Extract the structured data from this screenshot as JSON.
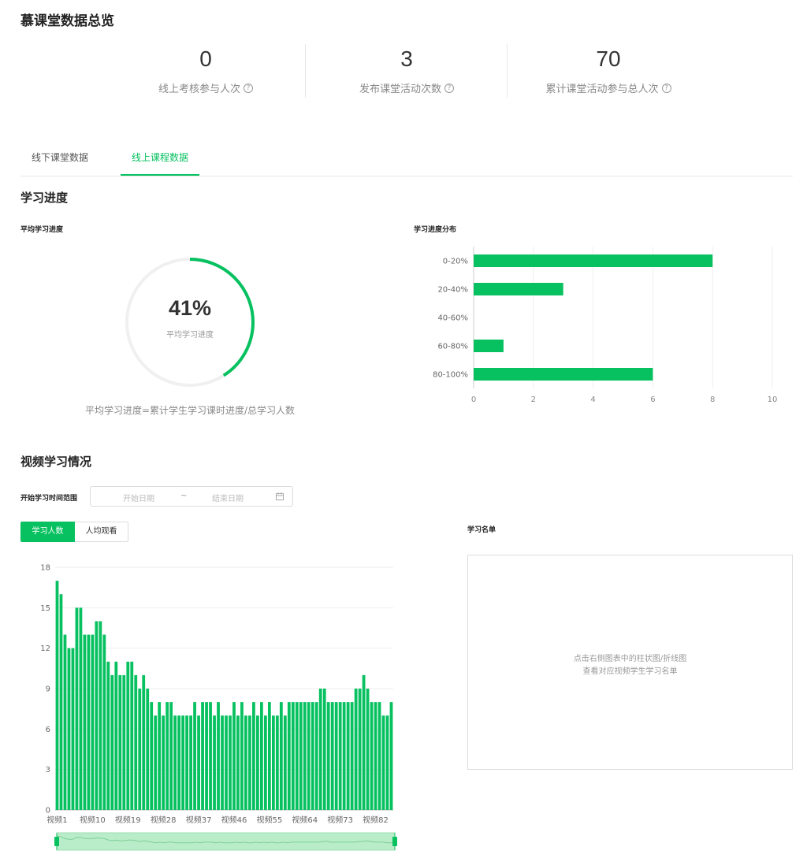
{
  "page_title": "慕课堂数据总览",
  "stats": [
    {
      "value": "0",
      "label": "线上考核参与人次",
      "help_icon": "question-circle-icon"
    },
    {
      "value": "3",
      "label": "发布课堂活动次数",
      "help_icon": "question-circle-icon"
    },
    {
      "value": "70",
      "label": "累计课堂活动参与总人次",
      "help_icon": "question-circle-icon"
    }
  ],
  "help_glyph": "?",
  "tabs": [
    {
      "label": "线下课堂数据",
      "active": false
    },
    {
      "label": "线上课程数据",
      "active": true
    }
  ],
  "progress_section": {
    "title": "学习进度",
    "avg_title": "平均学习进度",
    "avg_value": "41%",
    "avg_fraction": 0.41,
    "avg_label": "平均学习进度",
    "avg_caption": "平均学习进度=累计学生学习课时进度/总学习人数",
    "dist_title": "学习进度分布"
  },
  "video_section": {
    "title": "视频学习情况",
    "range_label": "开始学习时间范围",
    "start_placeholder": "开始日期",
    "separator": "~",
    "end_placeholder": "结束日期",
    "calendar_icon": "calendar-icon",
    "segments": [
      {
        "label": "学习人数",
        "active": true
      },
      {
        "label": "人均观看",
        "active": false
      }
    ],
    "list_title": "学习名单",
    "list_hint_1": "点击右侧图表中的柱状图/折线图",
    "list_hint_2": "查看对应视频学生学习名单"
  },
  "colors": {
    "accent": "#07c160",
    "ring_track": "#f0f0f0",
    "grid": "#eeeeee",
    "axis_text": "#666666"
  },
  "chart_data": [
    {
      "type": "bar",
      "orientation": "horizontal",
      "title": "学习进度分布",
      "categories": [
        "0-20%",
        "20-40%",
        "40-60%",
        "60-80%",
        "80-100%"
      ],
      "values": [
        8,
        3,
        0,
        1,
        6
      ],
      "xlim": [
        0,
        10
      ],
      "x_ticks": [
        0,
        2,
        4,
        6,
        8,
        10
      ],
      "grid": "vertical"
    },
    {
      "type": "bar",
      "title": "",
      "categories": [
        "视频1",
        "视频2",
        "视频3",
        "视频4",
        "视频5",
        "视频6",
        "视频7",
        "视频8",
        "视频9",
        "视频10",
        "视频11",
        "视频12",
        "视频13",
        "视频14",
        "视频15",
        "视频16",
        "视频17",
        "视频18",
        "视频19",
        "视频20",
        "视频21",
        "视频22",
        "视频23",
        "视频24",
        "视频25",
        "视频26",
        "视频27",
        "视频28",
        "视频29",
        "视频30",
        "视频31",
        "视频32",
        "视频33",
        "视频34",
        "视频35",
        "视频36",
        "视频37",
        "视频38",
        "视频39",
        "视频40",
        "视频41",
        "视频42",
        "视频43",
        "视频44",
        "视频45",
        "视频46",
        "视频47",
        "视频48",
        "视频49",
        "视频50",
        "视频51",
        "视频52",
        "视频53",
        "视频54",
        "视频55",
        "视频56",
        "视频57",
        "视频58",
        "视频59",
        "视频60",
        "视频61",
        "视频62",
        "视频63",
        "视频64",
        "视频65",
        "视频66",
        "视频67",
        "视频68",
        "视频69",
        "视频70",
        "视频71",
        "视频72",
        "视频73",
        "视频74",
        "视频75",
        "视频76",
        "视频77",
        "视频78",
        "视频79",
        "视频80",
        "视频81",
        "视频82"
      ],
      "values": [
        17,
        16,
        13,
        12,
        12,
        15,
        15,
        13,
        13,
        13,
        14,
        14,
        13,
        11,
        10,
        11,
        10,
        10,
        11,
        11,
        10,
        9,
        10,
        9,
        8,
        7,
        8,
        7,
        8,
        8,
        7,
        7,
        7,
        7,
        7,
        8,
        7,
        8,
        8,
        8,
        7,
        8,
        7,
        7,
        7,
        8,
        7,
        8,
        7,
        7,
        8,
        7,
        8,
        7,
        8,
        7,
        7,
        8,
        7,
        8,
        8,
        8,
        8,
        8,
        8,
        8,
        8,
        9,
        9,
        8,
        8,
        8,
        8,
        8,
        8,
        8,
        9,
        9,
        10,
        9,
        8,
        8,
        8,
        7,
        7,
        8
      ],
      "x_tick_labels": [
        "视频1",
        "视频10",
        "视频19",
        "视频28",
        "视频37",
        "视频46",
        "视频55",
        "视频64",
        "视频73",
        "视频82"
      ],
      "ylim": [
        0,
        18
      ],
      "y_ticks": [
        0,
        3,
        6,
        9,
        12,
        15,
        18
      ],
      "grid": "horizontal",
      "data_zoom": "full-range"
    }
  ]
}
